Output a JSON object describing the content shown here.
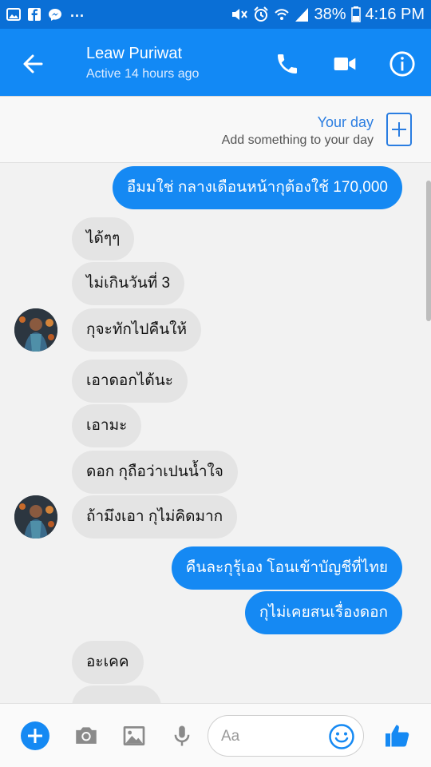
{
  "status_bar": {
    "battery": "38%",
    "time": "4:16 PM",
    "dots": "..."
  },
  "header": {
    "contact_name": "Leaw Puriwat",
    "status": "Active 14 hours ago"
  },
  "your_day": {
    "title": "Your day",
    "subtitle": "Add something to your day"
  },
  "messages": [
    {
      "text": "อืมมใช่ กลางเดือนหน้ากุต้องใช้ 170,000",
      "from": "me"
    },
    {
      "text": "ได้ๆๆ",
      "from": "them"
    },
    {
      "text": "ไม่เกินวันที่ 3",
      "from": "them"
    },
    {
      "text": "กุจะทักไปคืนให้",
      "from": "them"
    },
    {
      "text": "เอาดอกได้นะ",
      "from": "them"
    },
    {
      "text": "เอามะ",
      "from": "them"
    },
    {
      "text": "ดอก กุถือว่าเปนน้ำใจ",
      "from": "them"
    },
    {
      "text": "ถ้ามึงเอา กุไม่คิดมาก",
      "from": "them"
    },
    {
      "text": "คืนละกุรุ้เอง โอนเข้าบัญชีที่ไทย",
      "from": "me"
    },
    {
      "text": "กุไม่เคยสนเรื่องดอก",
      "from": "me"
    },
    {
      "text": "อะเคค",
      "from": "them"
    }
  ],
  "composer": {
    "placeholder": "Aa"
  },
  "colors": {
    "header": "#1289f5",
    "status_bar": "#0a6fd6",
    "outgoing_bubble": "#1589f3",
    "incoming_bubble": "#e4e4e4",
    "accent": "#2a7de1"
  },
  "icons": {
    "back": "arrow-left-icon",
    "call": "phone-icon",
    "video": "video-camera-icon",
    "info": "info-icon",
    "add_day": "plus-square-icon",
    "more": "plus-circle-icon",
    "camera": "camera-icon",
    "gallery": "image-icon",
    "voice": "microphone-icon",
    "emoji": "smiley-icon",
    "like": "thumbs-up-icon"
  }
}
